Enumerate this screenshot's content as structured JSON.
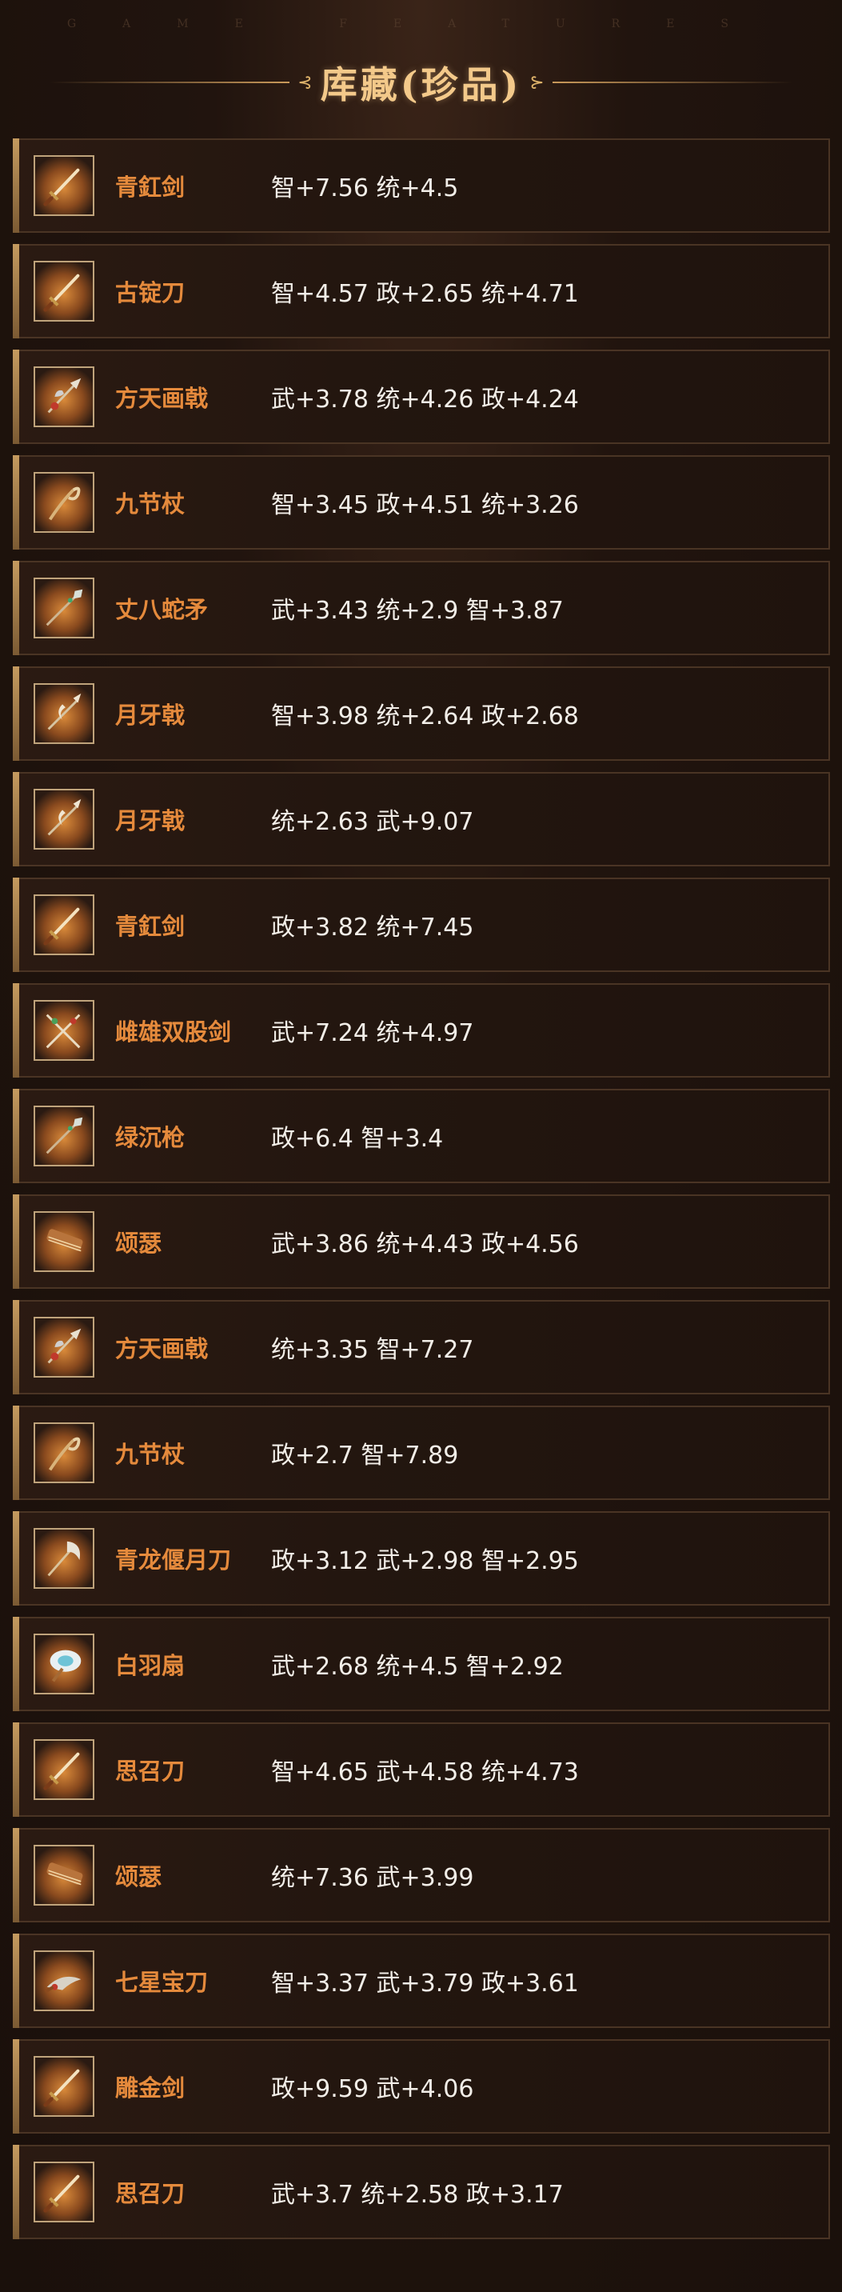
{
  "header": {
    "watermark": "GAME FEATURES",
    "title": "库藏(珍品)",
    "ornament_left": "⊰",
    "ornament_right": "⊱"
  },
  "items": [
    {
      "icon": "sword-icon",
      "name": "青釭剑",
      "stats": "智+7.56 统+4.5"
    },
    {
      "icon": "sword-icon",
      "name": "古锭刀",
      "stats": "智+4.57 政+2.65 统+4.71"
    },
    {
      "icon": "halberd-icon",
      "name": "方天画戟",
      "stats": "武+3.78 统+4.26 政+4.24"
    },
    {
      "icon": "staff-icon",
      "name": "九节杖",
      "stats": "智+3.45 政+4.51 统+3.26"
    },
    {
      "icon": "spear-icon",
      "name": "丈八蛇矛",
      "stats": "武+3.43 统+2.9 智+3.87"
    },
    {
      "icon": "crescent-halberd-icon",
      "name": "月牙戟",
      "stats": "智+3.98 统+2.64 政+2.68"
    },
    {
      "icon": "crescent-halberd-icon",
      "name": "月牙戟",
      "stats": "统+2.63 武+9.07"
    },
    {
      "icon": "sword-icon",
      "name": "青釭剑",
      "stats": "政+3.82 统+7.45"
    },
    {
      "icon": "twin-swords-icon",
      "name": "雌雄双股剑",
      "stats": "武+7.24 统+4.97"
    },
    {
      "icon": "spear-icon",
      "name": "绿沉枪",
      "stats": "政+6.4 智+3.4"
    },
    {
      "icon": "zither-icon",
      "name": "颂瑟",
      "stats": "武+3.86 统+4.43 政+4.56"
    },
    {
      "icon": "halberd-icon",
      "name": "方天画戟",
      "stats": "统+3.35 智+7.27"
    },
    {
      "icon": "staff-icon",
      "name": "九节杖",
      "stats": "政+2.7 智+7.89"
    },
    {
      "icon": "glaive-icon",
      "name": "青龙偃月刀",
      "stats": "政+3.12 武+2.98 智+2.95"
    },
    {
      "icon": "feather-fan-icon",
      "name": "白羽扇",
      "stats": "武+2.68 统+4.5 智+2.92"
    },
    {
      "icon": "sword-icon",
      "name": "思召刀",
      "stats": "智+4.65 武+4.58 统+4.73"
    },
    {
      "icon": "zither-icon",
      "name": "颂瑟",
      "stats": "统+7.36 武+3.99"
    },
    {
      "icon": "dragon-blade-icon",
      "name": "七星宝刀",
      "stats": "智+3.37 武+3.79 政+3.61"
    },
    {
      "icon": "sword-icon",
      "name": "雕金剑",
      "stats": "政+9.59 武+4.06"
    },
    {
      "icon": "sword-icon",
      "name": "思召刀",
      "stats": "武+3.7 统+2.58 政+3.17"
    }
  ]
}
